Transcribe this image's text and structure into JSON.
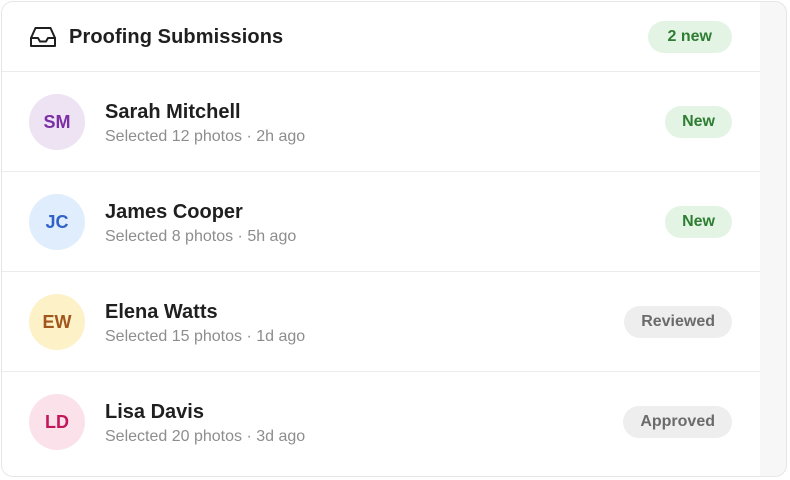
{
  "header": {
    "icon": "inbox-icon",
    "title": "Proofing Submissions",
    "badge": "2 new"
  },
  "submissions": [
    {
      "initials": "SM",
      "name": "Sarah Mitchell",
      "meta": "Selected 12 photos · 2h ago",
      "status": "New",
      "avatar_bg": "#ede3f3",
      "avatar_fg": "#7b2fa5"
    },
    {
      "initials": "JC",
      "name": "James Cooper",
      "meta": "Selected 8 photos · 5h ago",
      "status": "New",
      "avatar_bg": "#e0edfc",
      "avatar_fg": "#2f63c8"
    },
    {
      "initials": "EW",
      "name": "Elena Watts",
      "meta": "Selected 15 photos · 1d ago",
      "status": "Reviewed",
      "avatar_bg": "#fdf1c8",
      "avatar_fg": "#a0561c"
    },
    {
      "initials": "LD",
      "name": "Lisa Davis",
      "meta": "Selected 20 photos · 3d ago",
      "status": "Approved",
      "avatar_bg": "#fbe2ea",
      "avatar_fg": "#c2185b"
    }
  ],
  "colors": {
    "new_badge_bg": "#e3f4e4",
    "new_badge_text": "#2e7d32",
    "neutral_badge_bg": "#eeeeee",
    "neutral_badge_text": "#6b6b6b"
  }
}
